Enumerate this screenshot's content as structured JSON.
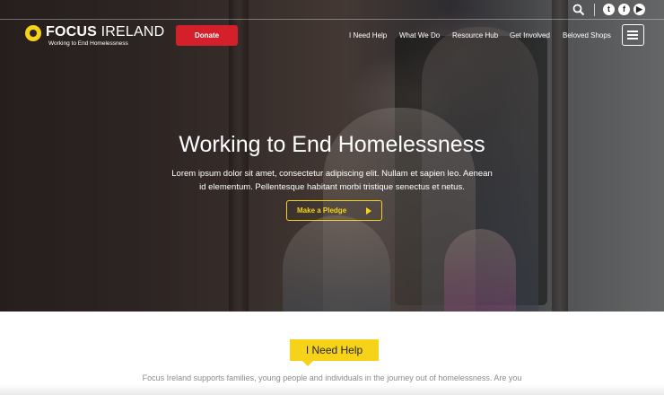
{
  "brand": {
    "name_bold": "FOCUS",
    "name_light": "IRELAND",
    "tagline": "Working to End Homelessness",
    "accent_yellow": "#f6d219",
    "donate_red": "#d4202a"
  },
  "topbar": {
    "icons": [
      "search-icon",
      "twitter-icon",
      "facebook-icon",
      "youtube-icon"
    ]
  },
  "header": {
    "donate_label": "Donate",
    "nav": [
      "I Need Help",
      "What We Do",
      "Resource Hub",
      "Get Involved",
      "Beloved Shops"
    ],
    "menu_icon": "hamburger-menu-icon"
  },
  "hero": {
    "title": "Working to End Homelessness",
    "body": "Lorem ipsum dolor sit amet, consectetur adipiscing elit. Nullam et sapien leo. Aenean id elementum. Pellentesque habitant morbi tristique senectus et netus.",
    "cta_label": "Make a Pledge"
  },
  "help_section": {
    "tag": "I Need Help",
    "intro": "Focus Ireland supports families, young people and individuals in the journey out of homelessness. Are you"
  }
}
